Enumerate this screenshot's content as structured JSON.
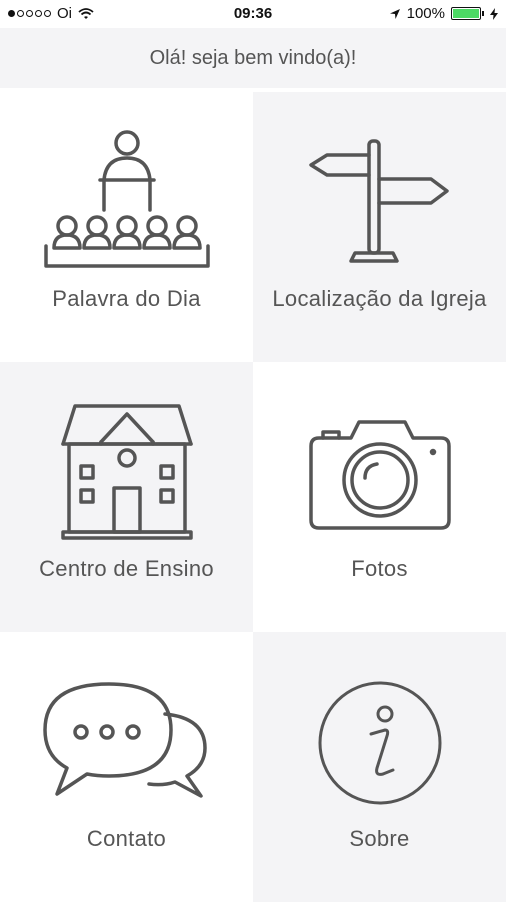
{
  "status_bar": {
    "carrier": "Oi",
    "time": "09:36",
    "battery": "100%",
    "signal_bars_filled": 1,
    "signal_bars_total": 5,
    "battery_level": 1.0
  },
  "header": {
    "title": "Olá! seja bem vindo(a)!"
  },
  "menu": [
    {
      "label": "Palavra do Dia",
      "icon": "preacher-icon"
    },
    {
      "label": "Localização da Igreja",
      "icon": "signpost-icon"
    },
    {
      "label": "Centro de Ensino",
      "icon": "building-icon"
    },
    {
      "label": "Fotos",
      "icon": "camera-icon"
    },
    {
      "label": "Contato",
      "icon": "chat-bubbles-icon"
    },
    {
      "label": "Sobre",
      "icon": "info-icon"
    }
  ],
  "colors": {
    "tile_gray": "#f4f4f6",
    "icon_stroke": "#555555",
    "battery_green": "#4cd964"
  }
}
